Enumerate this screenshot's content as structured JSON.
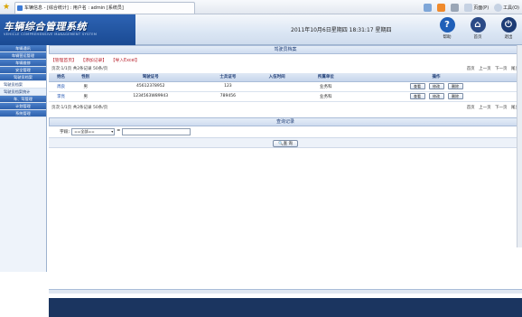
{
  "browser": {
    "tab_title": "车辆信息 - [综合统计] : 用户名 : admin [系统员]",
    "tools": [
      "页面(P)",
      "工具(O)"
    ]
  },
  "header": {
    "app_title": "车辆综合管理系统",
    "app_subtitle": "VEHICLE COMPREHENSIVE MANAGEMENT SYSTEM",
    "datetime": "2011年10月6日星期四 18:31:17 星期四",
    "buttons": [
      {
        "label": "帮助",
        "icon": "help-icon",
        "color": "#1f5fb8"
      },
      {
        "label": "首页",
        "icon": "home-icon",
        "color": "#2b4a86"
      },
      {
        "label": "退出",
        "icon": "exit-icon",
        "color": "#1d3c75"
      }
    ]
  },
  "sidebar": {
    "items": [
      {
        "label": "车辆通讯",
        "type": "header"
      },
      {
        "label": "车辆营运管理",
        "type": "header"
      },
      {
        "label": "车辆维修",
        "type": "header"
      },
      {
        "label": "安全管理",
        "type": "header"
      },
      {
        "label": "驾驶员档案",
        "type": "header"
      },
      {
        "label": "驾驶员档案",
        "type": "sub"
      },
      {
        "label": "驾驶员档案统计",
        "type": "sub",
        "active": true
      },
      {
        "label": "车、驾管理",
        "type": "header"
      },
      {
        "label": "计划管理",
        "type": "header"
      },
      {
        "label": "系统管理",
        "type": "header"
      }
    ]
  },
  "main": {
    "section_title": "驾驶员档案",
    "actions": [
      "【管理首页】",
      "【添加记录】",
      "【导入Excel】"
    ],
    "pager": {
      "info": "页次:1/1页 共2条记录 50条/页",
      "links": [
        "首页",
        "上一页",
        "下一页",
        "尾页"
      ]
    },
    "table": {
      "headers": [
        "姓名",
        "性别",
        "驾驶证号",
        "士兵证号",
        "入伍时间",
        "所属单位",
        "操作"
      ],
      "rows": [
        {
          "name": "周良",
          "gender": "男",
          "license": "45612378952",
          "soldier": "123",
          "enlist": "",
          "unit": "业务科",
          "ops": [
            "查看",
            "修改",
            "删除"
          ]
        },
        {
          "name": "李亮",
          "gender": "男",
          "license": "1234563W89943",
          "soldier": "789456",
          "enlist": "",
          "unit": "业务科",
          "ops": [
            "查看",
            "修改",
            "删除"
          ]
        }
      ]
    },
    "query": {
      "title": "查询记录",
      "field_label": "字段:",
      "select_value": "==全部==",
      "operator": "=",
      "input_value": "",
      "search_label": "查 询"
    }
  }
}
